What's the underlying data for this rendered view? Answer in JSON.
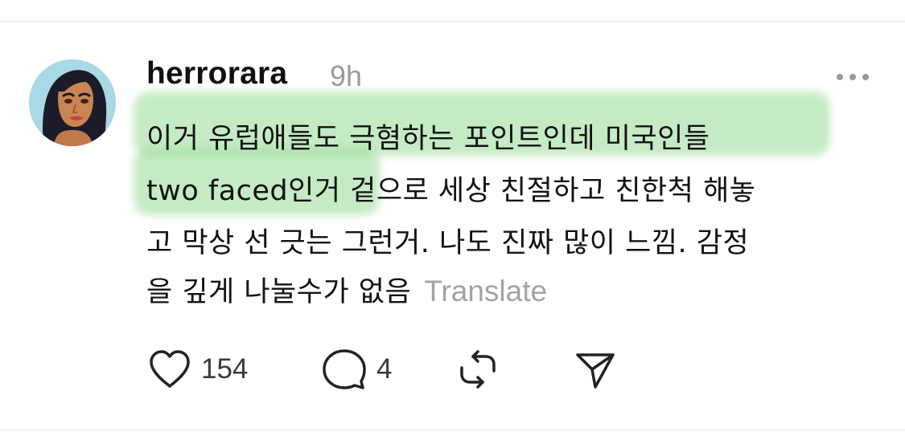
{
  "post": {
    "author": "herrorara",
    "timestamp": "9h",
    "text_lines": [
      "이거 유럽애들도 극혐하는 포인트인데 미국인들",
      "two faced인거 겉으로 세상 친절하고 친한척 해놓",
      "고 막상 선 긋는 그런거. 나도 진짜 많이 느낌. 감정",
      "을 깊게 나눌수가 없음"
    ],
    "translate_label": "Translate",
    "highlight_color": "#96da96"
  },
  "actions": {
    "likes": "154",
    "replies": "4"
  },
  "icons": [
    "avatar",
    "more-icon",
    "heart-icon",
    "comment-icon",
    "repost-icon",
    "share-icon"
  ]
}
